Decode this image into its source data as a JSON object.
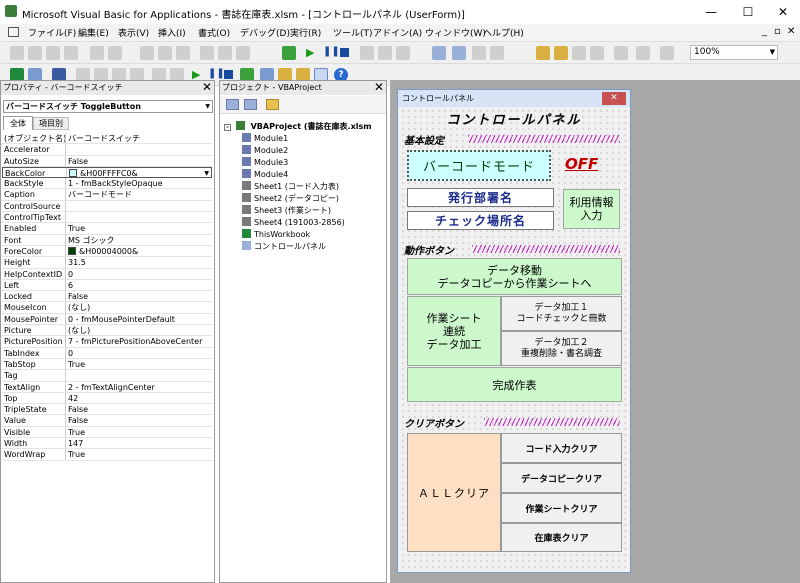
{
  "window": {
    "title": "Microsoft Visual Basic for Applications - 書誌在庫表.xlsm - [コントロールパネル (UserForm)]",
    "min": "—",
    "max": "☐",
    "close": "✕"
  },
  "menu": [
    "ファイル(F)",
    "編集(E)",
    "表示(V)",
    "挿入(I)",
    "書式(O)",
    "デバッグ(D)",
    "実行(R)",
    "ツール(T)",
    "アドイン(A)",
    "ウィンドウ(W)",
    "ヘルプ(H)"
  ],
  "toolbar": {
    "zoom": "100%"
  },
  "properties": {
    "header": "プロパティ - バーコードスイッチ",
    "object": "バーコードスイッチ ToggleButton",
    "tab_all": "全体",
    "tab_category": "項目別",
    "rows": [
      [
        "(オブジェクト名)",
        "バーコードスイッチ"
      ],
      [
        "Accelerator",
        ""
      ],
      [
        "AutoSize",
        "False"
      ],
      [
        "BackColor",
        "&H00FFFFC0&"
      ],
      [
        "BackStyle",
        "1 - fmBackStyleOpaque"
      ],
      [
        "Caption",
        "バーコードモード"
      ],
      [
        "ControlSource",
        ""
      ],
      [
        "ControlTipText",
        ""
      ],
      [
        "Enabled",
        "True"
      ],
      [
        "Font",
        "MS ゴシック"
      ],
      [
        "ForeColor",
        "&H00004000&"
      ],
      [
        "Height",
        "31.5"
      ],
      [
        "HelpContextID",
        "0"
      ],
      [
        "Left",
        "6"
      ],
      [
        "Locked",
        "False"
      ],
      [
        "MouseIcon",
        "(なし)"
      ],
      [
        "MousePointer",
        "0 - fmMousePointerDefault"
      ],
      [
        "Picture",
        "(なし)"
      ],
      [
        "PicturePosition",
        "7 - fmPicturePositionAboveCenter"
      ],
      [
        "TabIndex",
        "0"
      ],
      [
        "TabStop",
        "True"
      ],
      [
        "Tag",
        ""
      ],
      [
        "TextAlign",
        "2 - fmTextAlignCenter"
      ],
      [
        "Top",
        "42"
      ],
      [
        "TripleState",
        "False"
      ],
      [
        "Value",
        "False"
      ],
      [
        "Visible",
        "True"
      ],
      [
        "Width",
        "147"
      ],
      [
        "WordWrap",
        "True"
      ]
    ]
  },
  "project": {
    "header": "プロジェクト - VBAProject",
    "root": "VBAProject (書誌在庫表.xlsm",
    "items": [
      "Module1",
      "Module2",
      "Module3",
      "Module4",
      "Sheet1 (コード入力表)",
      "Sheet2 (データコピー)",
      "Sheet3 (作業シート)",
      "Sheet4 (191003-2856)",
      "ThisWorkbook",
      "コントロールパネル"
    ]
  },
  "form": {
    "caption": "コントロールパネル",
    "title": "コントロールパネル",
    "sec_basic": "基本設定",
    "barcode_mode": "バーコードモード",
    "off": "OFF",
    "issuer": "発行部署名",
    "check_place": "チェック場所名",
    "user_info": "利用情報\n入力",
    "sec_action": "動作ボタン",
    "move_data": "データ移動\nデータコピーから作業シートへ",
    "work_sheet": "作業シート\n連続\nデータ加工",
    "proc1": "データ加工１\nコードチェックと冊数",
    "proc2": "データ加工２\n重複削除・書名調査",
    "finish": "完成作表",
    "sec_clear": "クリアボタン",
    "all_clear": "ＡＬＬクリア",
    "clear_code": "コード入力クリア",
    "clear_copy": "データコピークリア",
    "clear_work": "作業シートクリア",
    "clear_stock": "在庫表クリア"
  },
  "colors": {
    "green": "#ccf8cc",
    "cyan": "#ccffff",
    "peach": "#fde0c4",
    "off": "#c00000",
    "hatch": "#c020c0"
  }
}
